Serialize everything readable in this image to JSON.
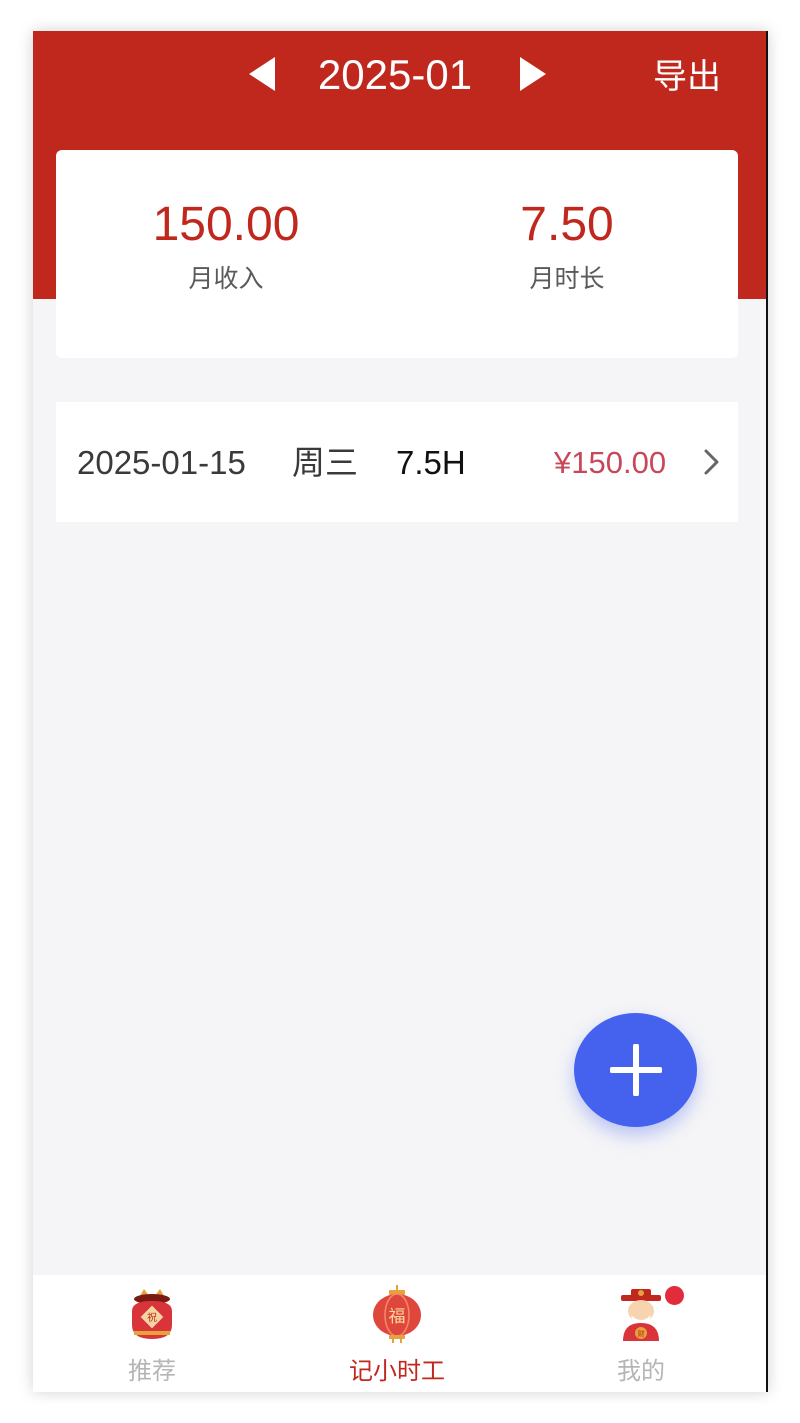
{
  "header": {
    "month": "2025-01",
    "export_label": "导出",
    "background_color": "#c0281e"
  },
  "summary": {
    "income_value": "150.00",
    "income_label": "月收入",
    "duration_value": "7.50",
    "duration_label": "月时长"
  },
  "records": [
    {
      "date": "2025-01-15",
      "weekday": "周三",
      "hours": "7.5H",
      "amount": "¥150.00"
    }
  ],
  "fab": {
    "icon": "plus-icon",
    "color": "#4462ee"
  },
  "tabbar": {
    "items": [
      {
        "label": "推荐",
        "icon": "lucky-jar-icon",
        "active": false
      },
      {
        "label": "记小时工",
        "icon": "fu-lantern-icon",
        "active": true
      },
      {
        "label": "我的",
        "icon": "fortune-god-icon",
        "active": false,
        "badge": true
      }
    ]
  }
}
